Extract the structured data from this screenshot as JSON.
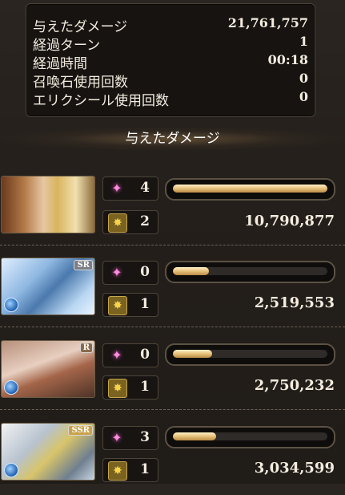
{
  "summary": [
    {
      "label": "与えたダメージ",
      "value": "21,761,757"
    },
    {
      "label": "経過ターン",
      "value": "1"
    },
    {
      "label": "経過時間",
      "value": "00:18"
    },
    {
      "label": "召喚石使用回数",
      "value": "0"
    },
    {
      "label": "エリクシール使用回数",
      "value": "0"
    }
  ],
  "section_title": "与えたダメージ",
  "icons": {
    "skill": "sparkle-icon",
    "ougi": "charge-attack-icon",
    "element": "water-element-icon"
  },
  "colors": {
    "accent_gold": "#e7c07a",
    "skill_pink": "#ff8ce0"
  },
  "characters": [
    {
      "rarity": "",
      "skill_count": "4",
      "ougi_count": "2",
      "damage": "10,790,877",
      "damage_fraction": 1.0,
      "element": ""
    },
    {
      "rarity": "SR",
      "skill_count": "0",
      "ougi_count": "1",
      "damage": "2,519,553",
      "damage_fraction": 0.233,
      "element": "water"
    },
    {
      "rarity": "R",
      "skill_count": "0",
      "ougi_count": "1",
      "damage": "2,750,232",
      "damage_fraction": 0.255,
      "element": "water"
    },
    {
      "rarity": "SSR",
      "skill_count": "3",
      "ougi_count": "1",
      "damage": "3,034,599",
      "damage_fraction": 0.281,
      "element": "water"
    }
  ]
}
